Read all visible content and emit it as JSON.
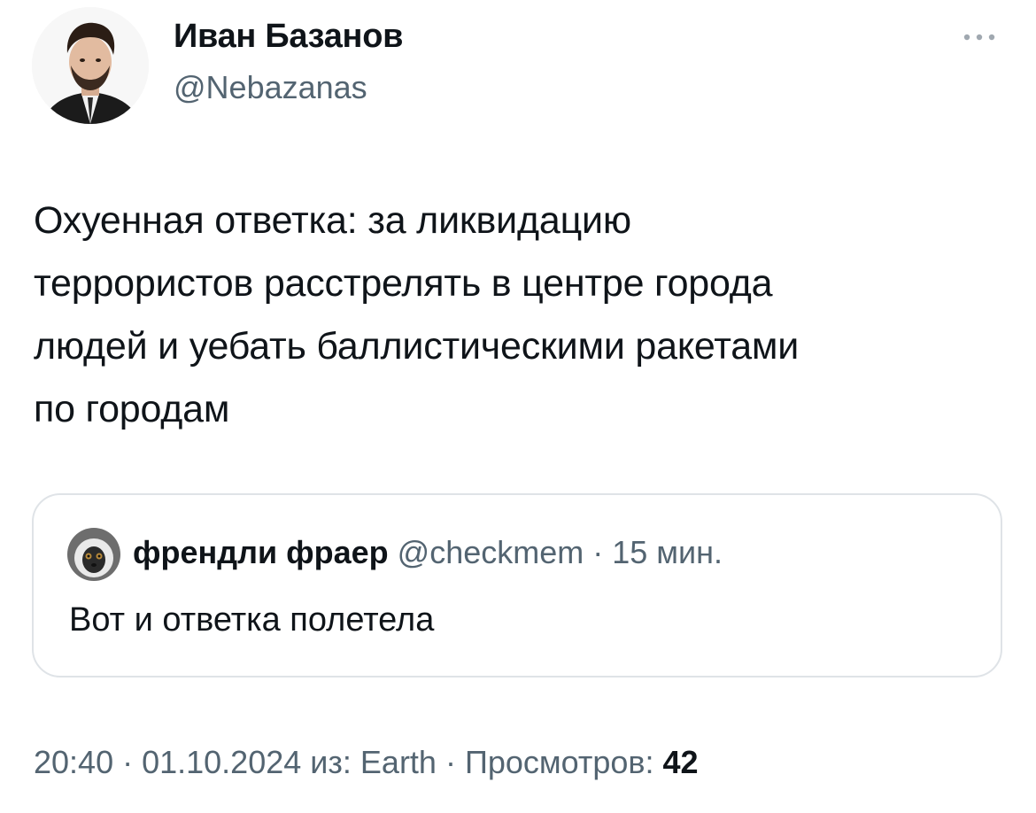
{
  "author": {
    "name": "Иван Базанов",
    "handle": "@Nebazanas"
  },
  "icons": {
    "more": "more-dots-icon",
    "avatar": "author-avatar",
    "quote_avatar": "quote-author-avatar"
  },
  "tweet": {
    "lines": [
      "Охуенная ответка: за ликвидацию",
      "террористов расстрелять в центре города",
      "людей и уебать баллистическими ракетами",
      "по городам"
    ]
  },
  "quote": {
    "name": "френдли фраер",
    "handle": "@checkmem",
    "separator": " · ",
    "time": "15 мин.",
    "text": "Вот и ответка полетела"
  },
  "meta": {
    "time": "20:40",
    "separator": " · ",
    "date": "01.10.2024",
    "source_prefix": " из: ",
    "source": "Earth",
    "views_label": "Просмотров: ",
    "views_count": "42"
  },
  "colors": {
    "text": "#0f1419",
    "secondary": "#536471",
    "border": "#dfe3e7"
  }
}
